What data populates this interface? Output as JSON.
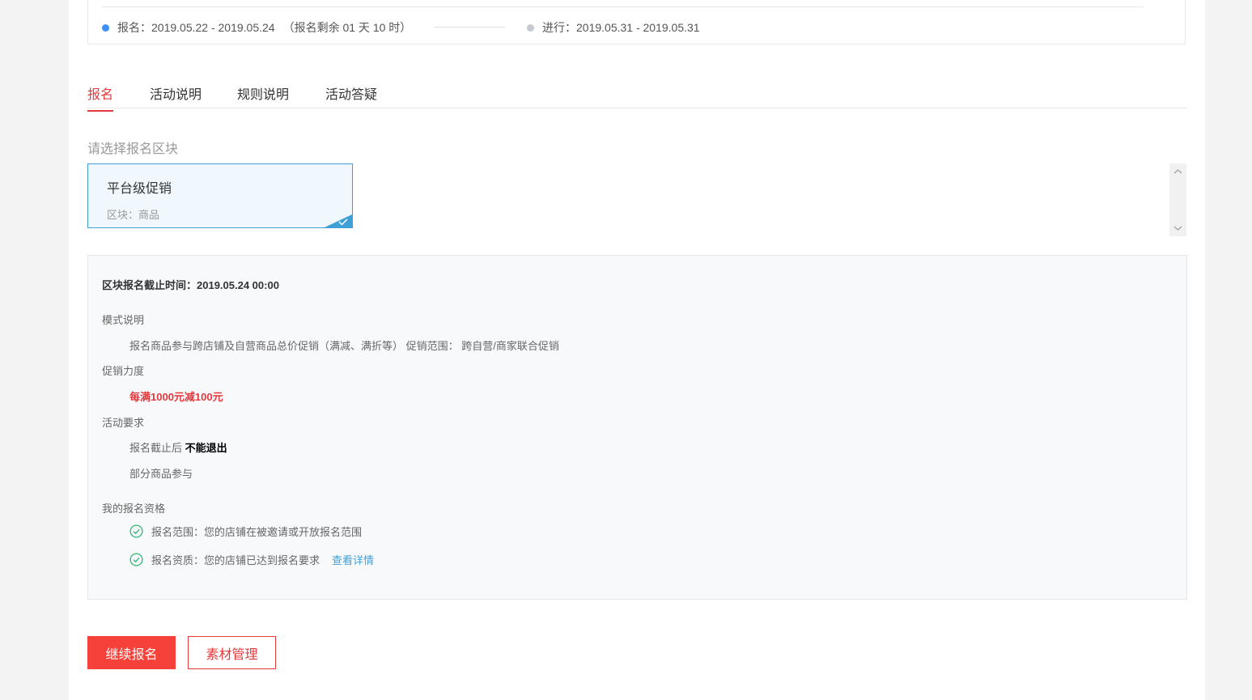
{
  "timeline": {
    "signup": {
      "label": "报名：",
      "range": "2019.05.22 - 2019.05.24",
      "remaining": "（报名剩余 01 天 10 时）",
      "color": "#3c8ff5"
    },
    "ongoing": {
      "label": "进行：",
      "range": "2019.05.31 - 2019.05.31",
      "color": "#c4c9d2"
    }
  },
  "tabs": [
    {
      "label": "报名",
      "active": true
    },
    {
      "label": "活动说明",
      "active": false
    },
    {
      "label": "规则说明",
      "active": false
    },
    {
      "label": "活动答疑",
      "active": false
    }
  ],
  "select_block_label": "请选择报名区块",
  "block": {
    "name": "平台级促销",
    "type": "区块：商品",
    "selected": true
  },
  "details": {
    "deadline": "区块报名截止时间：2019.05.24 00:00",
    "mode_title": "模式说明",
    "mode_text": "报名商品参与跨店铺及自营商品总价促销（满减、满折等） 促销范围： 跨自营/商家联合促销",
    "promo_title": "促销力度",
    "promo_text": "每满1000元减100元",
    "req_title": "活动要求",
    "req_line1_prefix": "报名截止后 ",
    "req_line1_strong": "不能退出",
    "req_line2": "部分商品参与",
    "qual_title": "我的报名资格",
    "qual1": "报名范围：您的店铺在被邀请或开放报名范围",
    "qual2": "报名资质：您的店铺已达到报名要求",
    "qual2_link": "查看详情"
  },
  "buttons": {
    "continue": "继续报名",
    "materials": "素材管理"
  },
  "colors": {
    "accent_red": "#e4393c",
    "accent_blue": "#3fa0d8",
    "success_green": "#2eb872"
  }
}
